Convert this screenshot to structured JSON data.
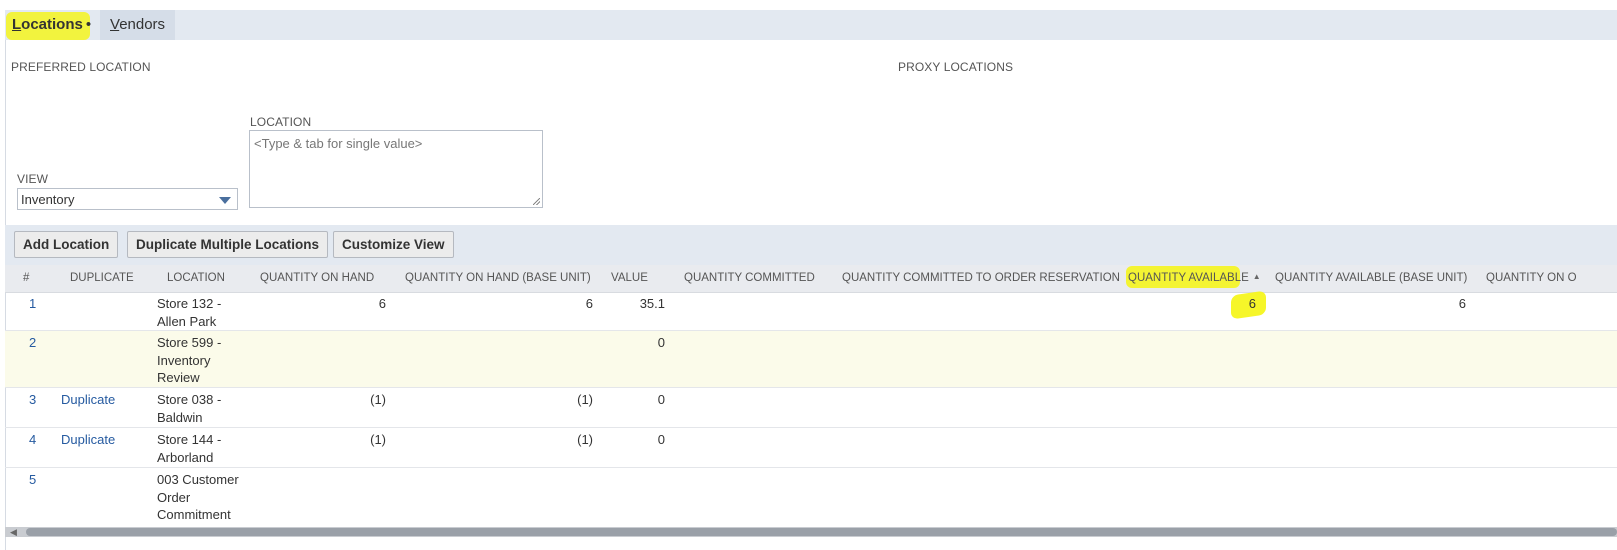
{
  "tabs": [
    {
      "label_hot": "L",
      "label_rest": "ocations",
      "marker": "•"
    },
    {
      "label_hot": "V",
      "label_rest": "endors"
    }
  ],
  "sections": {
    "preferred_location": "PREFERRED LOCATION",
    "proxy_locations": "PROXY LOCATIONS"
  },
  "filters": {
    "view_label": "VIEW",
    "view_value": "Inventory",
    "location_label": "LOCATION",
    "location_placeholder": "<Type & tab for single value>"
  },
  "buttons": {
    "add_location": "Add Location",
    "duplicate_multiple": "Duplicate Multiple Locations",
    "customize_view": "Customize View"
  },
  "table": {
    "columns": [
      "#",
      "DUPLICATE",
      "LOCATION",
      "QUANTITY ON HAND",
      "QUANTITY ON HAND (BASE UNIT)",
      "VALUE",
      "QUANTITY COMMITTED",
      "QUANTITY COMMITTED TO ORDER RESERVATION",
      "QUANTITY AVAILABLE",
      "QUANTITY AVAILABLE (BASE UNIT)",
      "QUANTITY ON O"
    ],
    "sort_indicator": "▲",
    "rows": [
      {
        "num": "1",
        "duplicate": "",
        "location": [
          "Store 132 -",
          "Allen Park"
        ],
        "qoh": "6",
        "qoh_base": "6",
        "value": "35.1",
        "qa": "6",
        "qa_base": "6"
      },
      {
        "num": "2",
        "duplicate": "",
        "location": [
          "Store 599 -",
          "Inventory",
          "Review"
        ],
        "qoh": "",
        "qoh_base": "",
        "value": "0",
        "qa": "",
        "qa_base": ""
      },
      {
        "num": "3",
        "duplicate": "Duplicate",
        "location": [
          "Store 038 -",
          "Baldwin"
        ],
        "qoh": "(1)",
        "qoh_base": "(1)",
        "value": "0",
        "qa": "",
        "qa_base": ""
      },
      {
        "num": "4",
        "duplicate": "Duplicate",
        "location": [
          "Store 144 -",
          "Arborland"
        ],
        "qoh": "(1)",
        "qoh_base": "(1)",
        "value": "0",
        "qa": "",
        "qa_base": ""
      },
      {
        "num": "5",
        "duplicate": "",
        "location": [
          "003 Customer",
          "Order",
          "Commitment"
        ],
        "qoh": "",
        "qoh_base": "",
        "value": "",
        "qa": "",
        "qa_base": ""
      }
    ]
  },
  "scrollbar": {
    "left_arrow": "◀"
  }
}
